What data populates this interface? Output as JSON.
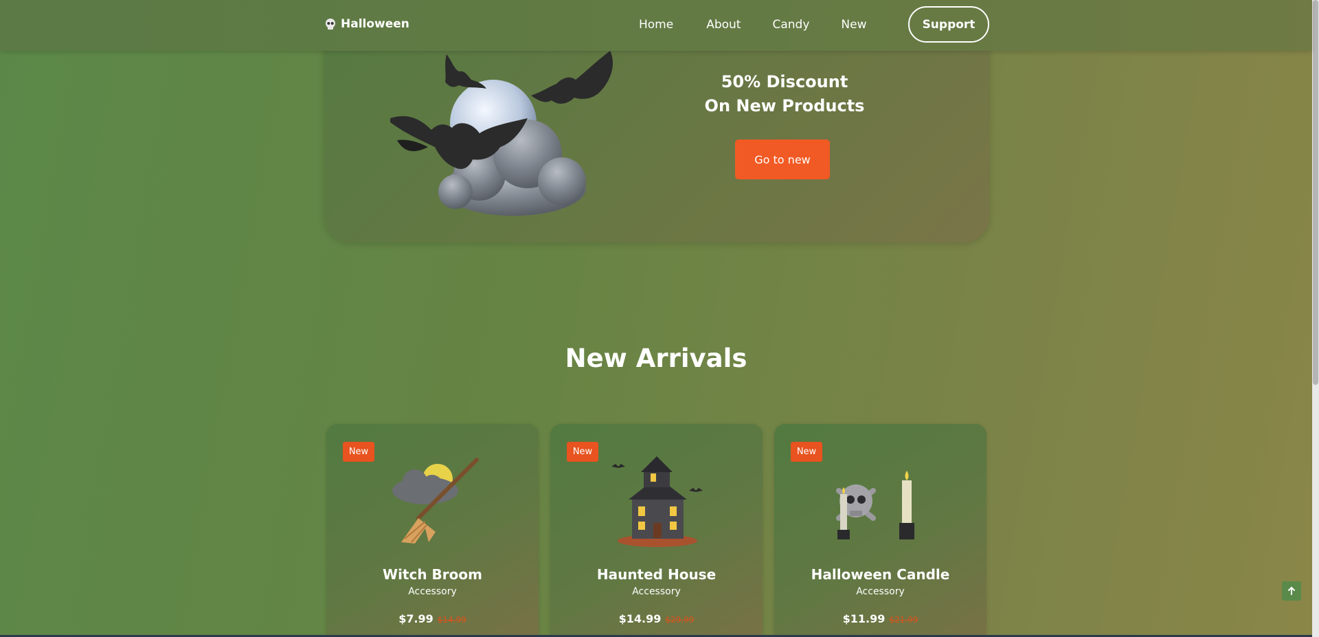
{
  "nav": {
    "brand": "Halloween",
    "links": [
      "Home",
      "About",
      "Candy",
      "New"
    ],
    "support": "Support"
  },
  "hero": {
    "title_line1": "50% Discount",
    "title_line2": "On New Products",
    "button": "Go to new"
  },
  "arrivals": {
    "title": "New Arrivals",
    "products": [
      {
        "badge": "New",
        "name": "Witch Broom",
        "category": "Accessory",
        "price": "$7.99",
        "old_price": "$14.99",
        "icon": "witch-broom-icon"
      },
      {
        "badge": "New",
        "name": "Haunted House",
        "category": "Accessory",
        "price": "$14.99",
        "old_price": "$29.99",
        "icon": "haunted-house-icon"
      },
      {
        "badge": "New",
        "name": "Halloween Candle",
        "category": "Accessory",
        "price": "$11.99",
        "old_price": "$21.99",
        "icon": "halloween-candle-icon"
      }
    ]
  },
  "colors": {
    "accent": "#f15a24",
    "badge": "#e8531f"
  }
}
